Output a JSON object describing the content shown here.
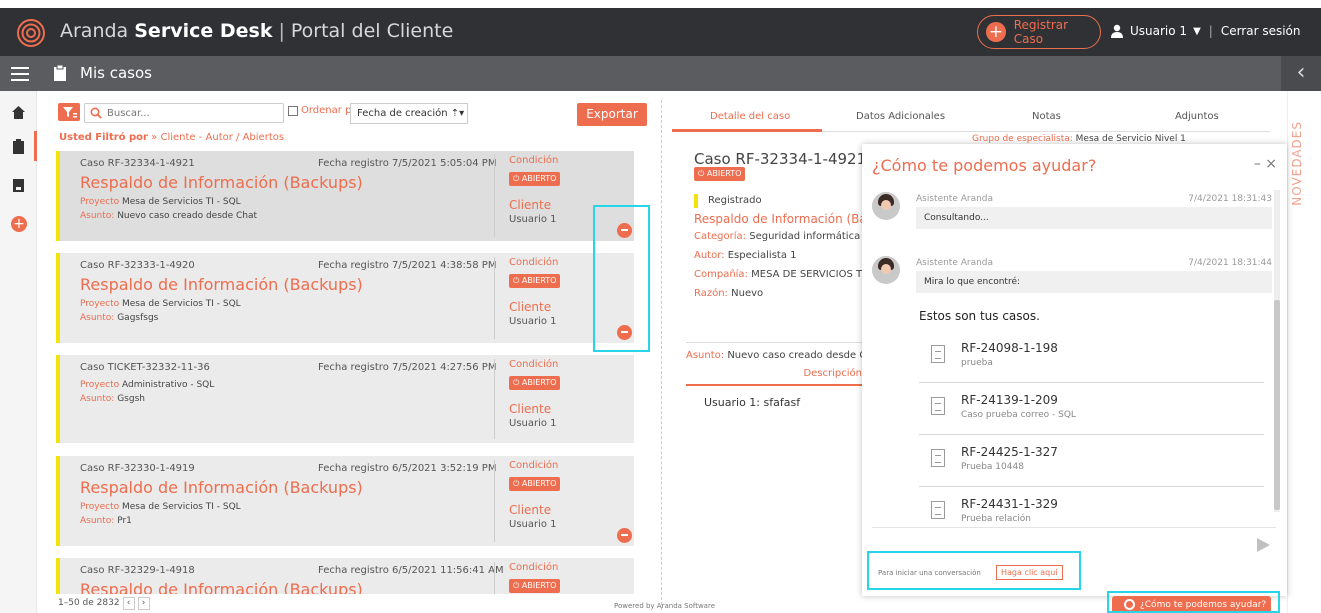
{
  "header": {
    "brand_light": "Aranda",
    "brand_bold": "Service Desk",
    "separator": "|",
    "portal": "Portal del Cliente",
    "register_button": "Registrar Caso",
    "user": "Usuario 1",
    "logout": "Cerrar sesión"
  },
  "subheader": {
    "title": "Mis casos",
    "back_icon": "chevron-left-icon"
  },
  "sidebar": {
    "items": [
      {
        "icon": "home-icon"
      },
      {
        "icon": "clipboard-icon"
      },
      {
        "icon": "book-icon"
      },
      {
        "icon": "add-icon",
        "label": "+"
      }
    ]
  },
  "toolbar": {
    "search_placeholder": "Buscar...",
    "order_label": "Ordenar por",
    "sort_value": "Fecha de creación ⇡▾",
    "export_label": "Exportar",
    "filter_prefix": "Usted Filtró por",
    "filter_value": "» Cliente - Autor / Abiertos"
  },
  "cases": [
    {
      "number": "Caso RF-32334-1-4921",
      "fecha": "Fecha registro 7/5/2021 5:05:04 PM",
      "title": "Respaldo de Información (Backups)",
      "proyecto_label": "Proyecto",
      "proyecto": "Mesa de Servicios TI - SQL",
      "asunto_label": "Asunto:",
      "asunto": "Nuevo caso creado desde Chat",
      "condicion": "Condición",
      "estado": "ABIERTO",
      "cliente_label": "Cliente",
      "cliente": "Usuario 1",
      "chat": true
    },
    {
      "number": "Caso RF-32333-1-4920",
      "fecha": "Fecha registro 7/5/2021 4:38:58 PM",
      "title": "Respaldo de Información (Backups)",
      "proyecto_label": "Proyecto",
      "proyecto": "Mesa de Servicios TI - SQL",
      "asunto_label": "Asunto:",
      "asunto": "Gagsfsgs",
      "condicion": "Condición",
      "estado": "ABIERTO",
      "cliente_label": "Cliente",
      "cliente": "Usuario 1",
      "chat": true
    },
    {
      "number": "Caso TICKET-32332-11-36",
      "fecha": "Fecha registro 7/5/2021 4:27:56 PM",
      "title": "",
      "proyecto_label": "Proyecto",
      "proyecto": "Administrativo - SQL",
      "asunto_label": "Asunto:",
      "asunto": "Gsgsh",
      "condicion": "Condición",
      "estado": "ABIERTO",
      "cliente_label": "Cliente",
      "cliente": "Usuario 1",
      "chat": false
    },
    {
      "number": "Caso RF-32330-1-4919",
      "fecha": "Fecha registro 6/5/2021 3:52:19 PM",
      "title": "Respaldo de Información (Backups)",
      "proyecto_label": "Proyecto",
      "proyecto": "Mesa de Servicios TI - SQL",
      "asunto_label": "Asunto:",
      "asunto": "Pr1",
      "condicion": "Condición",
      "estado": "ABIERTO",
      "cliente_label": "Cliente",
      "cliente": "Usuario 1",
      "chat": true
    },
    {
      "number": "Caso RF-32329-1-4918",
      "fecha": "Fecha registro 6/5/2021 11:56:41 AM",
      "title": "Respaldo de Información (Backups)",
      "condicion": "Condición",
      "estado": "ABIERTO"
    }
  ],
  "pager": {
    "text": "1–50 de 2832",
    "prev": "‹",
    "next": "›"
  },
  "powered": "Powered by Aranda Software",
  "detail": {
    "tabs": [
      "Detalle del caso",
      "Datos Adicionales",
      "Notas",
      "Adjuntos"
    ],
    "case_number": "Caso RF-32334-1-4921",
    "estado": "ABIERTO",
    "registrado": "Registrado",
    "title": "Respaldo de Información (Backups)",
    "grupo_label": "Grupo de especialista:",
    "grupo": "Mesa de Servicio Nivel 1",
    "categoria_label": "Categoría:",
    "categoria": "Seguridad informática",
    "autor_label": "Autor:",
    "autor": "Especialista 1",
    "compania_label": "Compañía:",
    "compania": "MESA DE SERVICIOS TI",
    "razon_label": "Razón:",
    "razon": "Nuevo",
    "asunto_label": "Asunto:",
    "asunto": "Nuevo caso creado desde C",
    "desc_tab": "Descripción",
    "desc": "Usuario 1: sfafasf"
  },
  "novedades": "NOVEDADES",
  "chat": {
    "title": "¿Cómo te podemos ayudar?",
    "controls": "– ×",
    "messages": [
      {
        "who": "Asistente Aranda",
        "time": "7/4/2021 18:31:43",
        "text": "Consultando..."
      },
      {
        "who": "Asistente Aranda",
        "time": "7/4/2021 18:31:44",
        "text": "Mira lo que encontré:"
      }
    ],
    "cases_header": "Estos son tus casos.",
    "cases": [
      {
        "id": "RF-24098-1-198",
        "sub": "prueba"
      },
      {
        "id": "RF-24139-1-209",
        "sub": "Caso prueba correo - SQL"
      },
      {
        "id": "RF-24425-1-327",
        "sub": "Prueba 10448"
      },
      {
        "id": "RF-24431-1-329",
        "sub": "Prueba relación"
      }
    ],
    "start_text": "Para iniciar una conversación",
    "start_link": "Haga clic aquí",
    "float_button": "¿Cómo te podemos ayudar?"
  },
  "colors": {
    "accent": "#ee6d4e",
    "topbar": "#2f3135",
    "highlight": "#26d6e8",
    "status_bar": "#f2e30c"
  }
}
